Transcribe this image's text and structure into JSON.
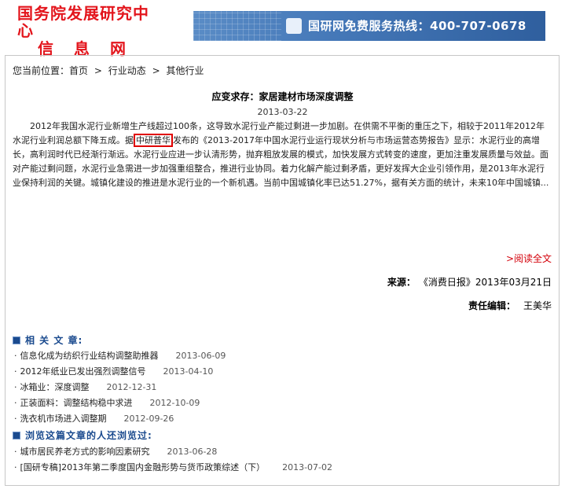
{
  "header": {
    "logo_line1": "国务院发展研究中心",
    "logo_line2": "信息网",
    "banner_text": "国研网免费服务热线：400-707-0678"
  },
  "breadcrumb": [
    "您当前位置：首页",
    "行业动态",
    "其他行业"
  ],
  "article": {
    "title": "应变求存：家居建材市场深度调整",
    "date": "2013-03-22",
    "p_before": "2012年我国水泥行业新增生产线超过100条，这导致水泥行业产能过剩进一步加剧。在供需不平衡的重压之下，相较于2011年2012年水泥行业利润总额下降五成。据",
    "highlight": "中研普华",
    "p_after": "发布的《2013-2017年中国水泥行业运行现状分析与市场运营态势报告》显示：水泥行业的高增长，高利润时代已经渐行渐远。水泥行业应进一步认清形势，抛弃粗放发展的模式，加快发展方式转变的速度，更加注重发展质量与效益。面对产能过剩问题，水泥行业急需进一步加强重组整合，推进行业协同。着力化解产能过剩矛盾，更好发挥大企业引领作用，是2013年水泥行业保持利润的关键。城镇化建设的推进是水泥行业的一个新机遇。当前中国城镇化率已达51.27%，据有关方面的统计，未来10年中国城镇..."
  },
  "read_more": ">阅读全文",
  "source_label": "来源：",
  "source_value": "《消费日报》2013年03月21日",
  "editor_label": "责任编辑：",
  "editor_value": "王美华",
  "related": {
    "title": "相 关 文 章:",
    "items": [
      {
        "title": "信息化成为纺织行业结构调整助推器",
        "date": "2013-06-09"
      },
      {
        "title": "2012年纸业已发出强烈调整信号",
        "date": "2013-04-10"
      },
      {
        "title": "冰箱业：深度调整",
        "date": "2012-12-31"
      },
      {
        "title": "正装面料：调整结构稳中求进",
        "date": "2012-10-09"
      },
      {
        "title": "洗衣机市场进入调整期",
        "date": "2012-09-26"
      }
    ]
  },
  "also_viewed": {
    "title": "浏览这篇文章的人还浏览过:",
    "items": [
      {
        "title": "城市居民养老方式的影响因素研究",
        "date": "2013-06-28"
      },
      {
        "title": "[国研专稿]2013年第二季度国内金融形势与货币政策综述（下）",
        "date": "2013-07-02"
      }
    ]
  }
}
